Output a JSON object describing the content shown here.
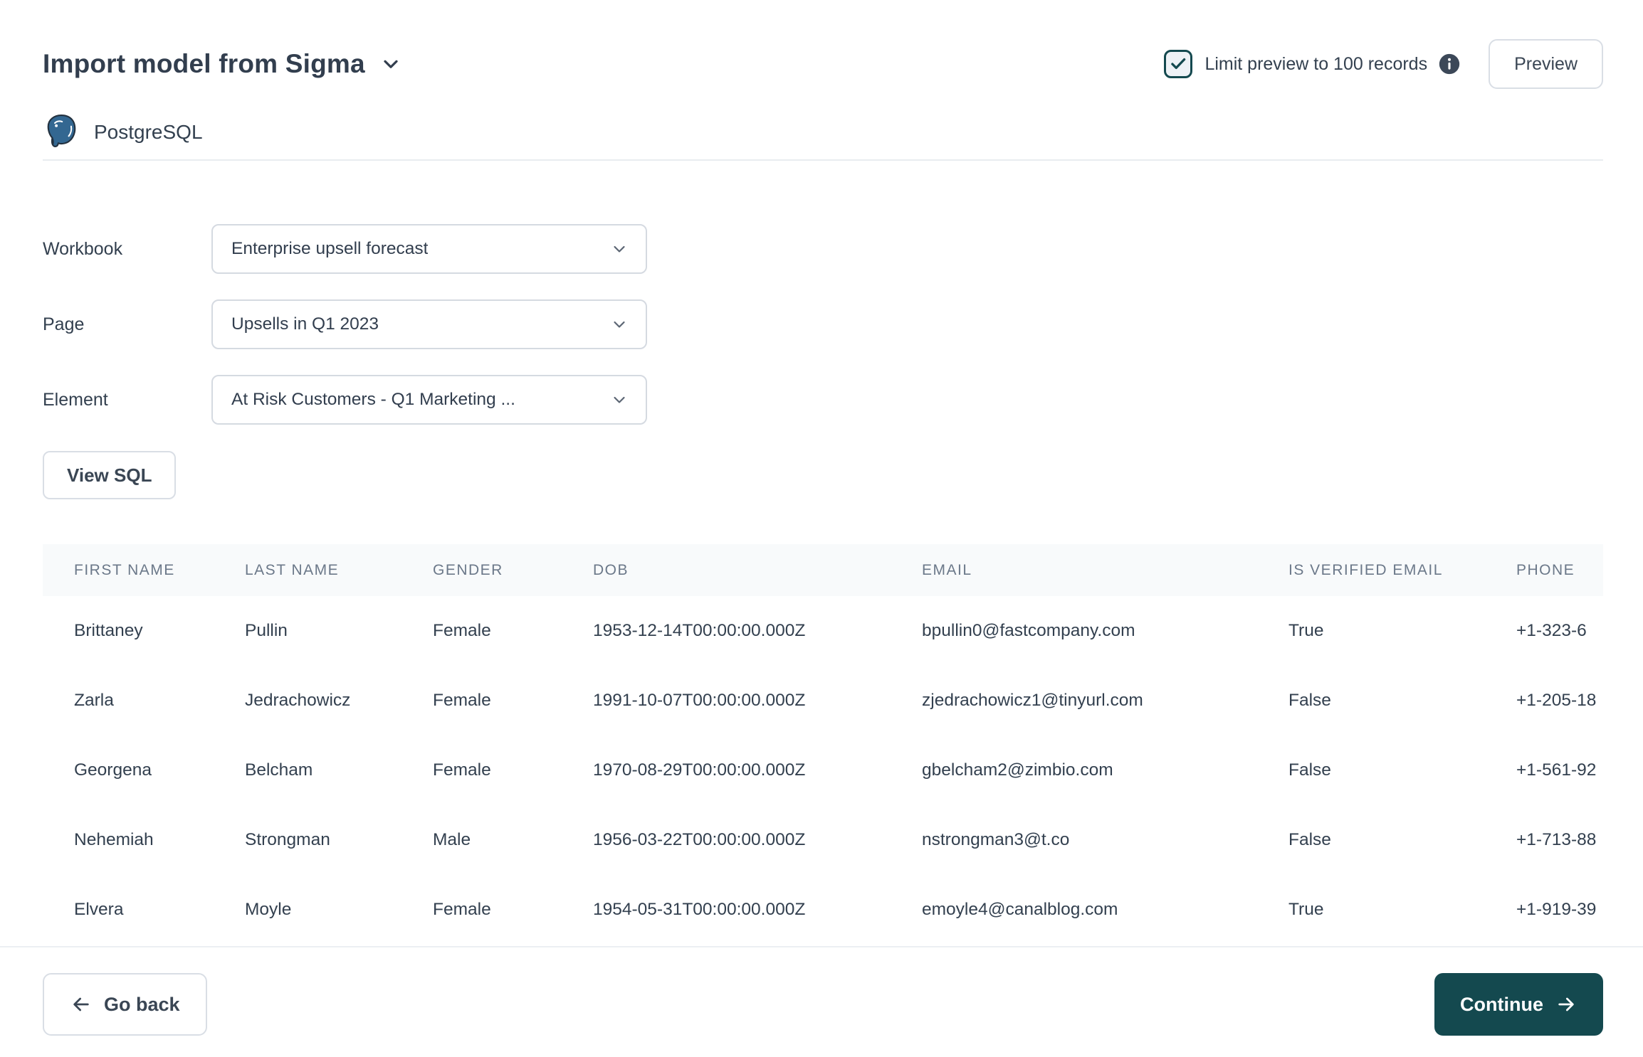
{
  "header": {
    "title": "Import model from Sigma",
    "limit_checkbox": {
      "label": "Limit preview to 100 records",
      "checked": true
    },
    "preview_button": "Preview"
  },
  "source": {
    "name": "PostgreSQL"
  },
  "form": {
    "fields": [
      {
        "label": "Workbook",
        "value": "Enterprise upsell forecast"
      },
      {
        "label": "Page",
        "value": "Upsells in Q1 2023"
      },
      {
        "label": "Element",
        "value": "At Risk Customers - Q1 Marketing ..."
      }
    ],
    "view_sql_button": "View SQL"
  },
  "table": {
    "columns": [
      "FIRST NAME",
      "LAST NAME",
      "GENDER",
      "DOB",
      "EMAIL",
      "IS VERIFIED EMAIL",
      "PHONE"
    ],
    "rows": [
      [
        "Brittaney",
        "Pullin",
        "Female",
        "1953-12-14T00:00:00.000Z",
        "bpullin0@fastcompany.com",
        "True",
        "+1-323-6"
      ],
      [
        "Zarla",
        "Jedrachowicz",
        "Female",
        "1991-10-07T00:00:00.000Z",
        "zjedrachowicz1@tinyurl.com",
        "False",
        "+1-205-18"
      ],
      [
        "Georgena",
        "Belcham",
        "Female",
        "1970-08-29T00:00:00.000Z",
        "gbelcham2@zimbio.com",
        "False",
        "+1-561-92"
      ],
      [
        "Nehemiah",
        "Strongman",
        "Male",
        "1956-03-22T00:00:00.000Z",
        "nstrongman3@t.co",
        "False",
        "+1-713-88"
      ],
      [
        "Elvera",
        "Moyle",
        "Female",
        "1954-05-31T00:00:00.000Z",
        "emoyle4@canalblog.com",
        "True",
        "+1-919-39"
      ]
    ]
  },
  "footer": {
    "go_back_button": "Go back",
    "continue_button": "Continue"
  },
  "colors": {
    "accent_teal": "#14494F",
    "postgres_blue": "#336791",
    "text_dark": "#333F4E",
    "table_header_bg": "#F8FAFB"
  }
}
